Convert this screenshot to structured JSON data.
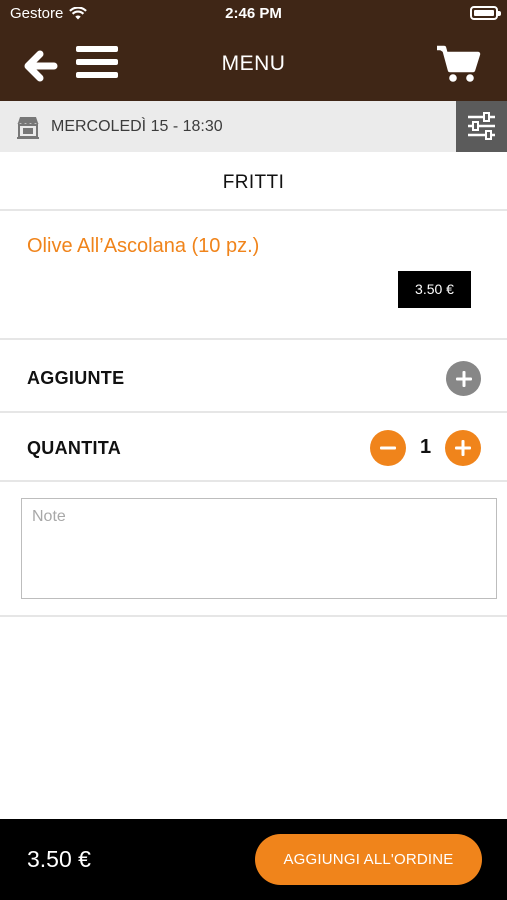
{
  "status_bar": {
    "carrier": "Gestore",
    "time": "2:46 PM"
  },
  "nav": {
    "title": "MENU",
    "icons": [
      "back-arrow-icon",
      "hamburger-menu-icon",
      "shopping-cart-icon"
    ]
  },
  "date_bar": {
    "date": "MERCOLEDÌ 15 - 18:30",
    "icons": [
      "store-icon",
      "filter-sliders-icon"
    ]
  },
  "category": {
    "label": "FRITTI"
  },
  "product": {
    "name": "Olive All’Ascolana (10 pz.)",
    "price": "3.50 €"
  },
  "addons": {
    "label": "AGGIUNTE"
  },
  "quantity": {
    "label": "QUANTITA",
    "value": "1"
  },
  "notes": {
    "placeholder": "Note",
    "value": ""
  },
  "footer": {
    "total": "3.50 €",
    "add_button": "AGGIUNGI ALL'ORDINE"
  },
  "colors": {
    "header_brown": "#3f2616",
    "accent_orange": "#f0841b",
    "date_bar_gray": "#ebebeb",
    "filter_gray": "#5b5b5b",
    "addon_gray": "#878787",
    "footer_black": "#000000"
  }
}
